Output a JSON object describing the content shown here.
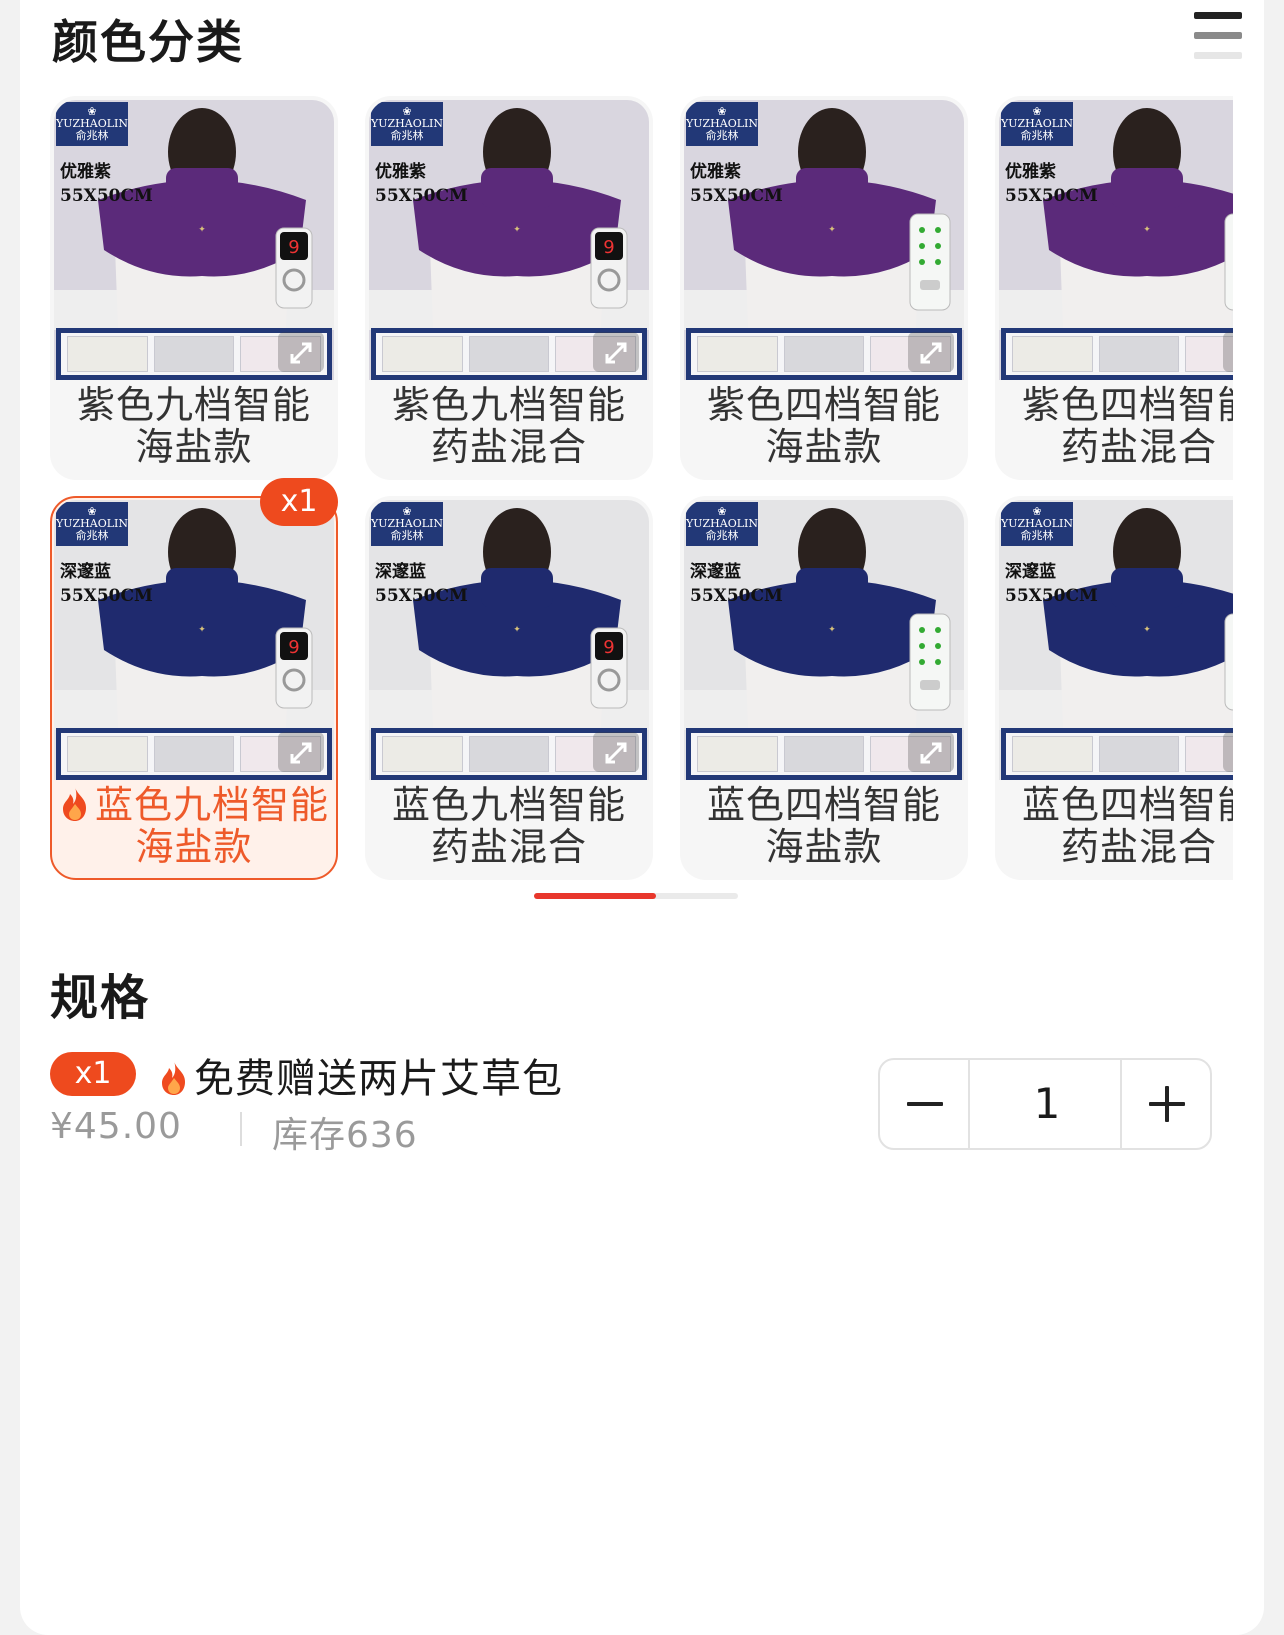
{
  "colors": {
    "accent": "#ee4a1e",
    "selected_bg": "#fff1ea",
    "purple_pad": "#5b2a7a",
    "blue_pad": "#1f2a6e",
    "brand_navy": "#223877"
  },
  "color_section": {
    "title": "颜色分类",
    "toggle_icon": "list-layout-icon",
    "options": [
      {
        "name_line1": "紫色九档智能",
        "name_line2": "海盐款",
        "tone": "purple",
        "img_variant": "优雅紫",
        "img_size": "55X50CM",
        "remote": "nine",
        "selected": false,
        "badge": ""
      },
      {
        "name_line1": "紫色九档智能",
        "name_line2": "药盐混合",
        "tone": "purple",
        "img_variant": "优雅紫",
        "img_size": "55X50CM",
        "remote": "nine",
        "selected": false,
        "badge": ""
      },
      {
        "name_line1": "紫色四档智能",
        "name_line2": "海盐款",
        "tone": "purple",
        "img_variant": "优雅紫",
        "img_size": "55X50CM",
        "remote": "four",
        "selected": false,
        "badge": ""
      },
      {
        "name_line1": "紫色四档智能",
        "name_line2": "药盐混合",
        "tone": "purple",
        "img_variant": "优雅紫",
        "img_size": "55X50CM",
        "remote": "four",
        "selected": false,
        "badge": ""
      },
      {
        "name_line1": "蓝色九档智能",
        "name_line2": "海盐款",
        "tone": "blue",
        "img_variant": "深邃蓝",
        "img_size": "55X50CM",
        "remote": "nine",
        "selected": true,
        "badge": "x1"
      },
      {
        "name_line1": "蓝色九档智能",
        "name_line2": "药盐混合",
        "tone": "blue",
        "img_variant": "深邃蓝",
        "img_size": "55X50CM",
        "remote": "nine",
        "selected": false,
        "badge": ""
      },
      {
        "name_line1": "蓝色四档智能",
        "name_line2": "海盐款",
        "tone": "blue",
        "img_variant": "深邃蓝",
        "img_size": "55X50CM",
        "remote": "four",
        "selected": false,
        "badge": ""
      },
      {
        "name_line1": "蓝色四档智能",
        "name_line2": "药盐混合",
        "tone": "blue",
        "img_variant": "深邃蓝",
        "img_size": "55X50CM",
        "remote": "four",
        "selected": false,
        "badge": ""
      }
    ],
    "brand_en": "YUZHAOLIN",
    "brand_cn": "俞兆林",
    "pager_progress": 0.6
  },
  "spec_section": {
    "title": "规格",
    "badge": "x1",
    "name": "免费赠送两片艾草包",
    "price": "¥45.00",
    "stock": "库存636",
    "quantity": "1",
    "decrement_icon": "minus-icon",
    "increment_icon": "plus-icon"
  }
}
